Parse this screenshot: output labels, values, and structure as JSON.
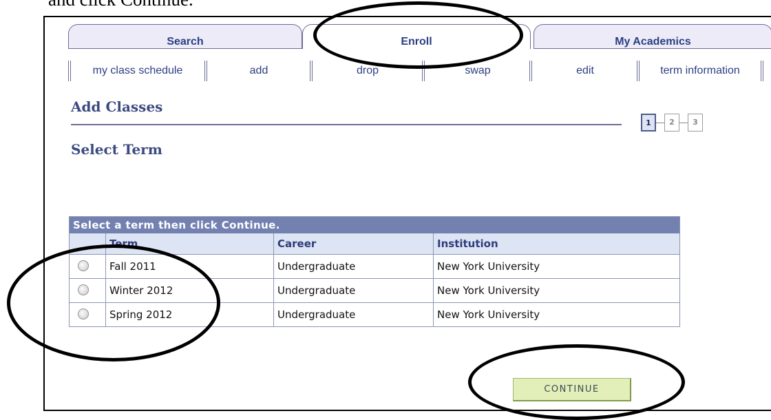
{
  "caption": "and click Continue.",
  "tabs": [
    "Search",
    "Enroll",
    "My Academics"
  ],
  "subtabs": [
    "my class schedule",
    "add",
    "drop",
    "swap",
    "edit",
    "term information"
  ],
  "headings": {
    "add_classes": "Add Classes",
    "select_term": "Select Term"
  },
  "steps": [
    "1",
    "2",
    "3"
  ],
  "grid": {
    "title": "Select a term then click Continue.",
    "columns": [
      "",
      "Term",
      "Career",
      "Institution"
    ],
    "rows": [
      {
        "term": "Fall 2011",
        "career": "Undergraduate",
        "institution": "New York University"
      },
      {
        "term": "Winter 2012",
        "career": "Undergraduate",
        "institution": "New York University"
      },
      {
        "term": "Spring 2012",
        "career": "Undergraduate",
        "institution": "New York University"
      }
    ]
  },
  "continue_label": "CONTINUE",
  "colors": {
    "header_blue": "#7381b1",
    "link_blue": "#2b3f82",
    "button_green": "#e3efb8"
  }
}
